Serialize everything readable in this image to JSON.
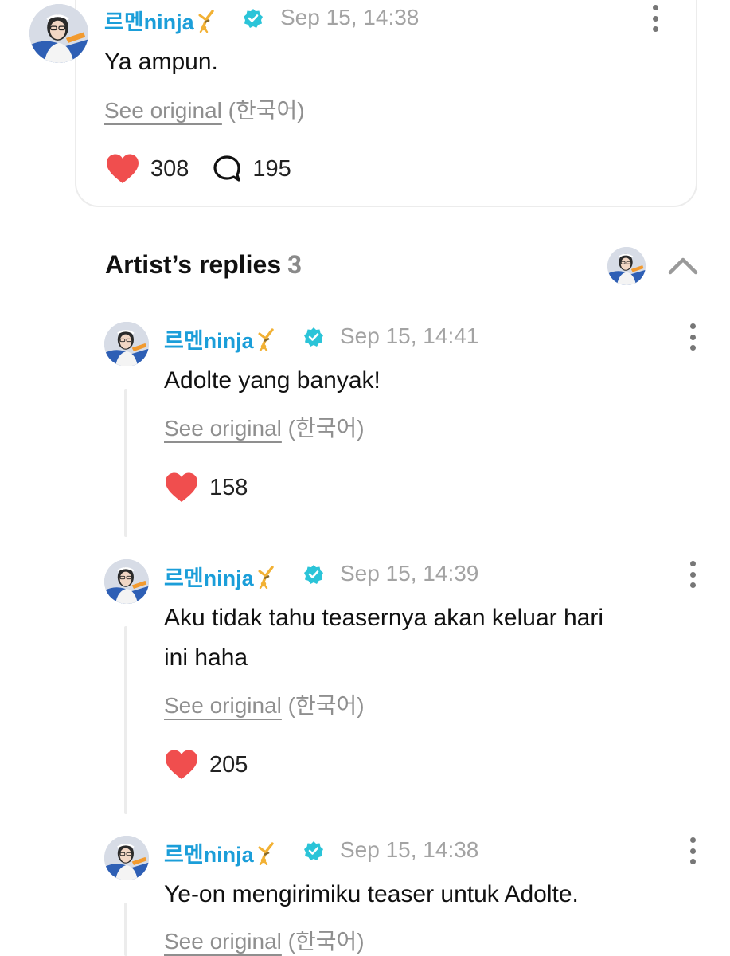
{
  "main_post": {
    "author": "르멘ninja",
    "timestamp": "Sep 15, 14:38",
    "text": "Ya ampun.",
    "see_original_label": "See original",
    "original_language": "(한국어)",
    "likes": "308",
    "comments": "195"
  },
  "artist_replies": {
    "title": "Artist’s replies",
    "count": "3",
    "collapse_icon": "chevron-up-icon"
  },
  "replies": [
    {
      "author": "르멘ninja",
      "timestamp": "Sep 15, 14:41",
      "text": "Adolte yang banyak!",
      "see_original_label": "See original",
      "original_language": "(한국어)",
      "likes": "158"
    },
    {
      "author": "르멘ninja",
      "timestamp": "Sep 15, 14:39",
      "text_line1": "Aku tidak tahu teasernya akan keluar hari",
      "text_line2": "ini haha",
      "see_original_label": "See original",
      "original_language": "(한국어)",
      "likes": "205"
    },
    {
      "author": "르멘ninja",
      "timestamp": "Sep 15, 14:38",
      "text": "Ye-on mengirimiku teaser untuk Adolte.",
      "see_original_label": "See original",
      "original_language": "(한국어)"
    }
  ],
  "colors": {
    "author_name": "#1b9ed9",
    "verified_badge": "#2bc4d8",
    "heart": "#f04e4e",
    "muted_text": "#a3a3a3"
  }
}
